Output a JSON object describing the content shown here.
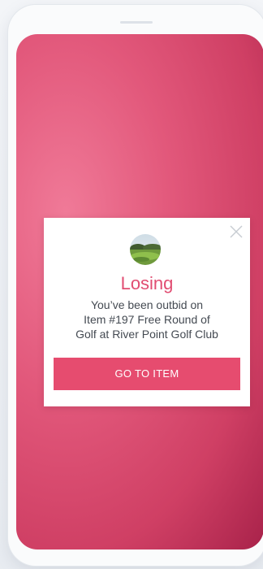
{
  "colors": {
    "accent": "#e64c6f",
    "title": "#e14d72",
    "backdrop_light": "#f07a98",
    "backdrop_dark": "#a8224a",
    "modal_background": "#ffffff",
    "text": "#444a52"
  },
  "modal": {
    "close_icon": "close-icon",
    "image": "golf-course-thumbnail",
    "title": "Losing",
    "message_lines": [
      "You’ve been outbid on",
      "Item #197 Free Round of",
      "Golf at River Point Golf Club"
    ],
    "button_label": "GO TO ITEM"
  }
}
